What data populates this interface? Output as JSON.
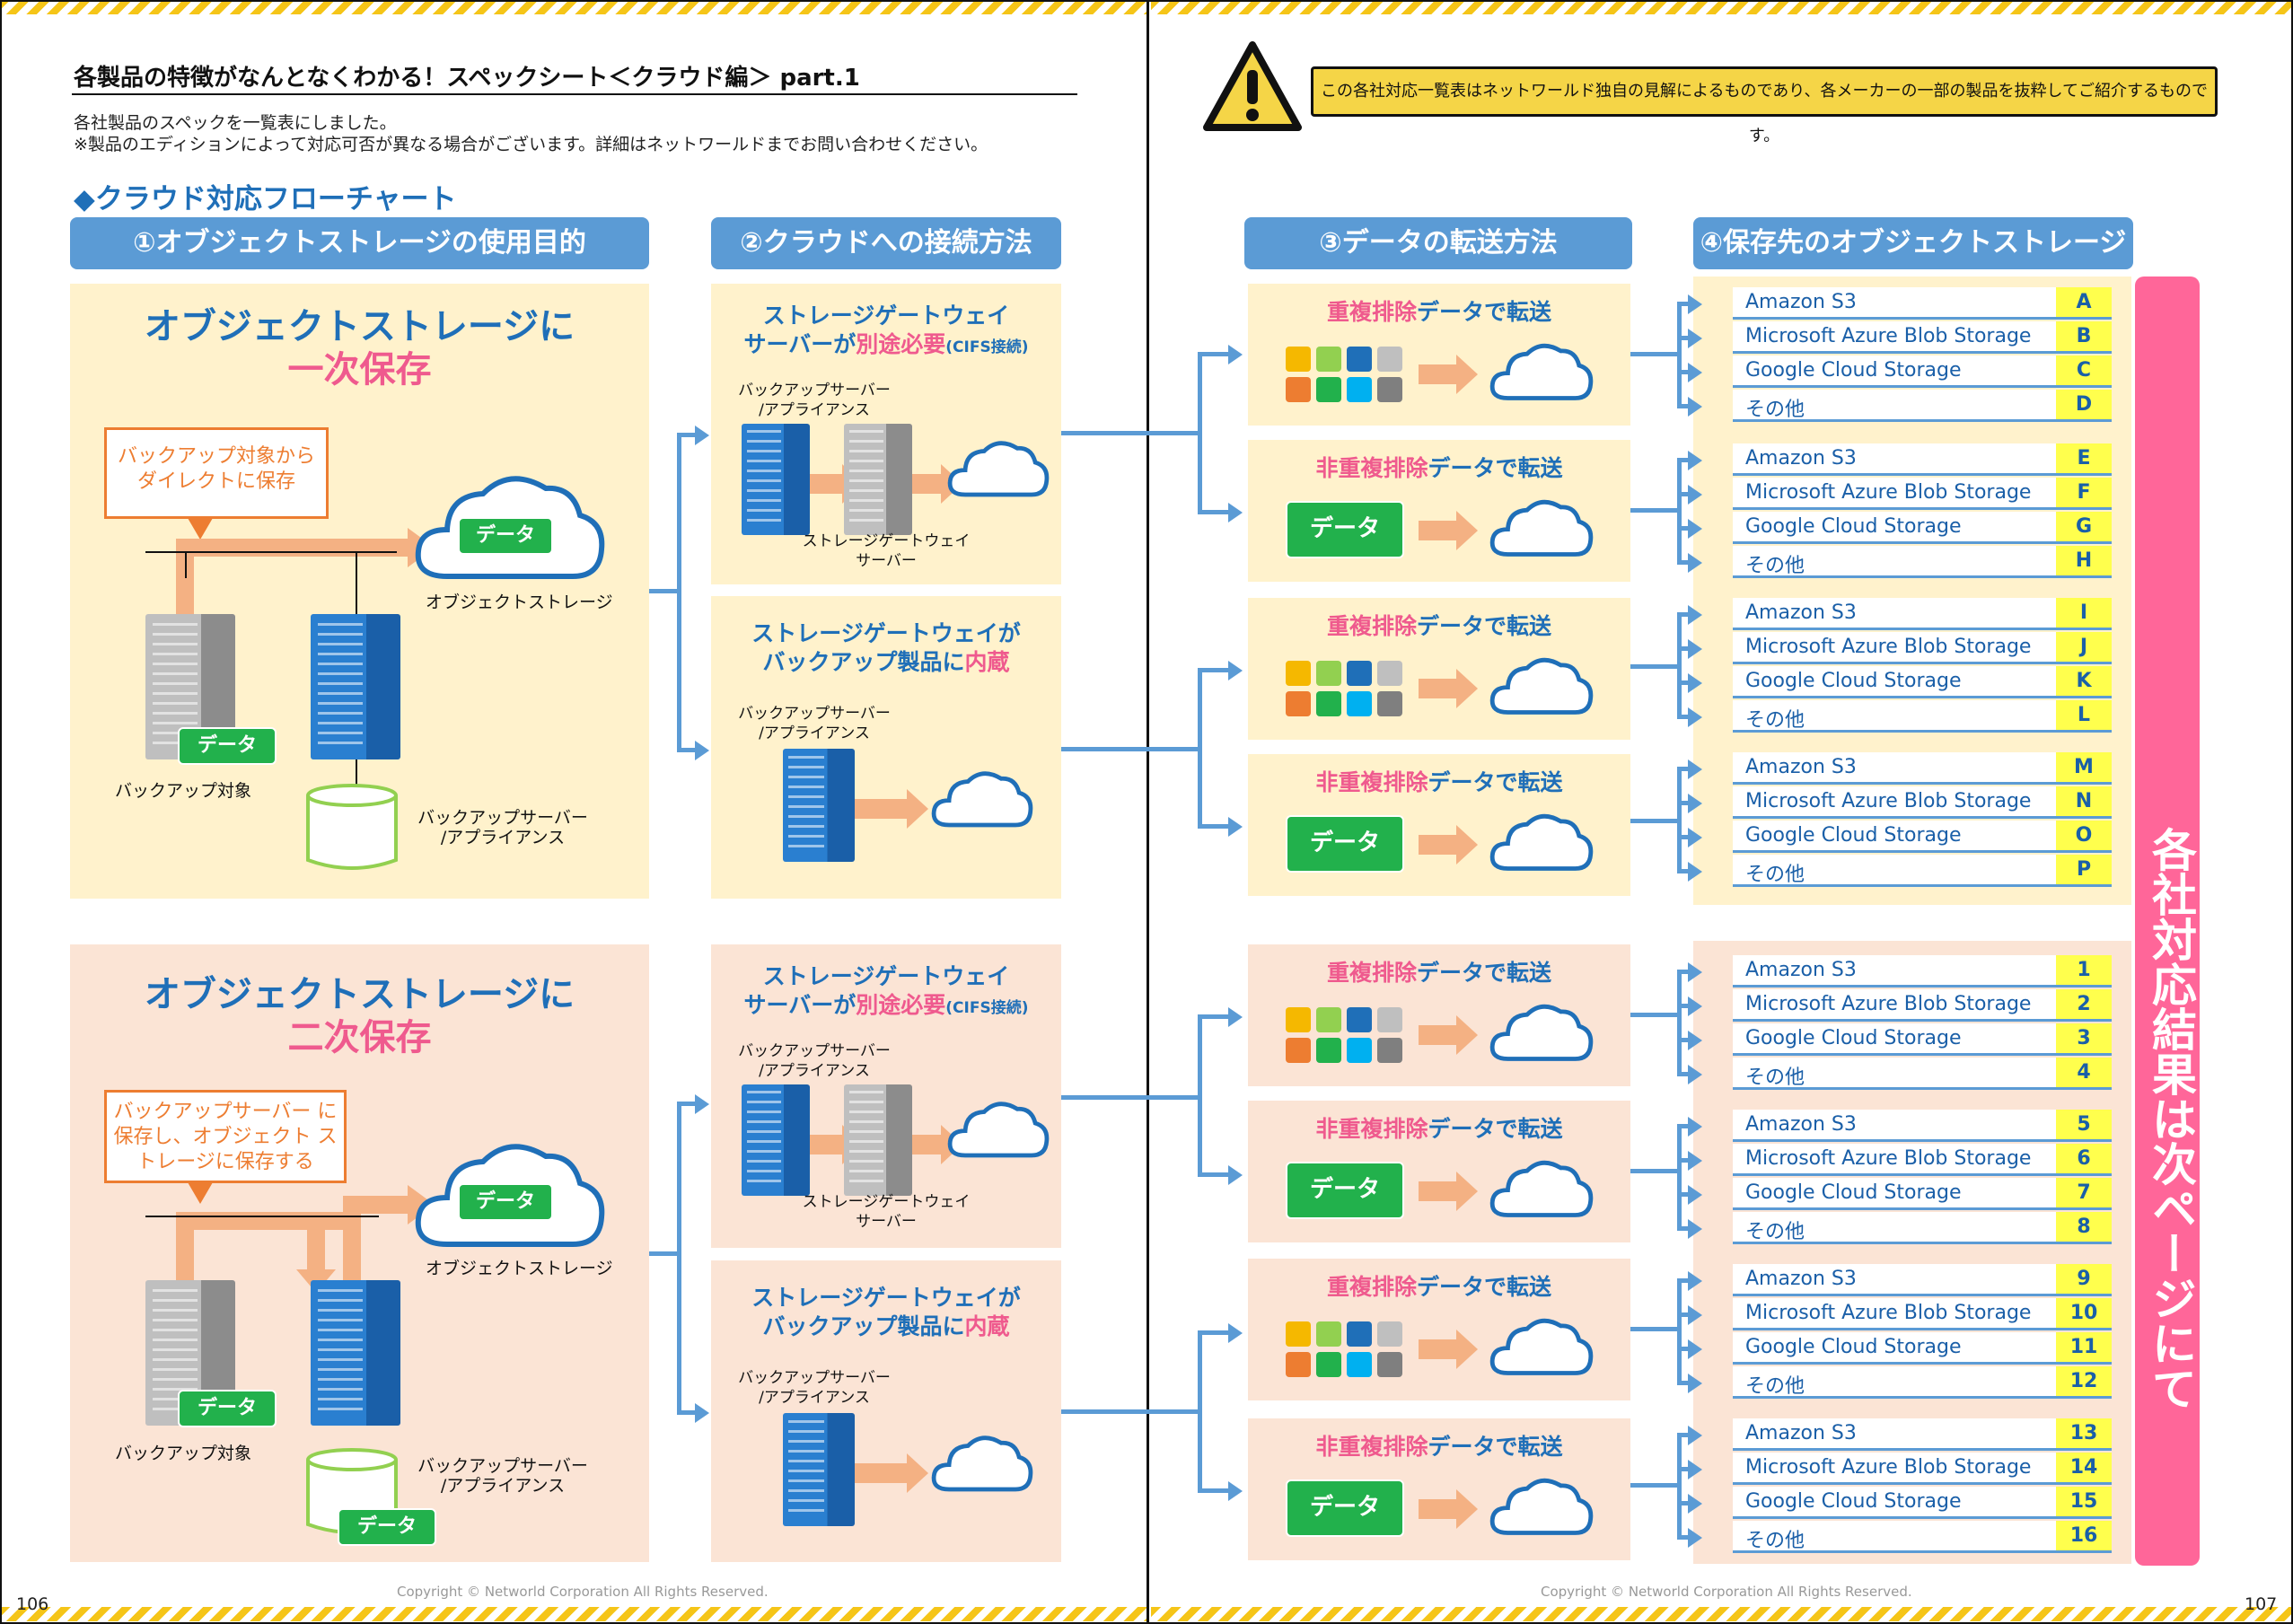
{
  "header": {
    "title": "各製品の特徴がなんとなくわかる！スペックシート＜クラウド編＞ part.1",
    "desc1": "各社製品のスペックを一覧表にしました。",
    "desc2": "※製品のエディションによって対応可否が異なる場合がございます。詳細はネットワールドまでお問い合わせください。",
    "section": "◆クラウド対応フローチャート",
    "notice": "この各社対応一覧表はネットワールド独自の見解によるものであり、各メーカーの一部の製品を抜粋してご紹介するものです。"
  },
  "columns": [
    "①オブジェクトストレージの使用目的",
    "②クラウドへの接続方法",
    "③データの転送方法",
    "④保存先のオブジェクトストレージ"
  ],
  "purpose": {
    "primary_line1": "オブジェクトストレージに",
    "primary_line2": "一次保存",
    "primary_callout": "バックアップ対象から ダイレクトに保存",
    "secondary_line1": "オブジェクトストレージに",
    "secondary_line2": "二次保存",
    "secondary_callout": "バックアップサーバー に保存し、オブジェクト ストレージに保存する",
    "data": "データ",
    "object_storage": "オブジェクトストレージ",
    "backup_target": "バックアップ対象",
    "backup_server": "バックアップサーバー\n/アプライアンス"
  },
  "connection": {
    "gw_required_a": "ストレージゲートウェイ",
    "gw_required_b": "サーバーが",
    "gw_required_c": "別途必要",
    "gw_required_d": "(CIFS接続)",
    "gw_builtin_a": "ストレージゲートウェイが",
    "gw_builtin_b": "バックアップ製品に",
    "gw_builtin_c": "内蔵",
    "backup_server": "バックアップサーバー\n/アプライアンス",
    "gw_server": "ストレージゲートウェイ\nサーバー"
  },
  "transfer": {
    "dedup_a": "重複排除",
    "dedup_b": "データで転送",
    "nondedup_a": "非重複排除",
    "nondedup_b": "データで転送",
    "data": "データ"
  },
  "storage_names": [
    "Amazon S3",
    "Microsoft Azure Blob Storage",
    "Google Cloud Storage",
    "その他"
  ],
  "storage_codes": [
    "A",
    "B",
    "C",
    "D",
    "E",
    "F",
    "G",
    "H",
    "I",
    "J",
    "K",
    "L",
    "M",
    "N",
    "O",
    "P",
    "1",
    "2",
    "3",
    "4",
    "5",
    "6",
    "7",
    "8",
    "9",
    "10",
    "11",
    "12",
    "13",
    "14",
    "15",
    "16"
  ],
  "side_banner": "各社対応結果は次ページにて",
  "footer": {
    "copyright": "Copyright © Networld Corporation All Rights Reserved.",
    "page_left": "106",
    "page_right": "107"
  },
  "colors": {
    "blue": "#5b9bd5",
    "pink": "#ff6699",
    "yellow": "#f5d547",
    "green": "#22b14c",
    "orange": "#ed7d31"
  }
}
